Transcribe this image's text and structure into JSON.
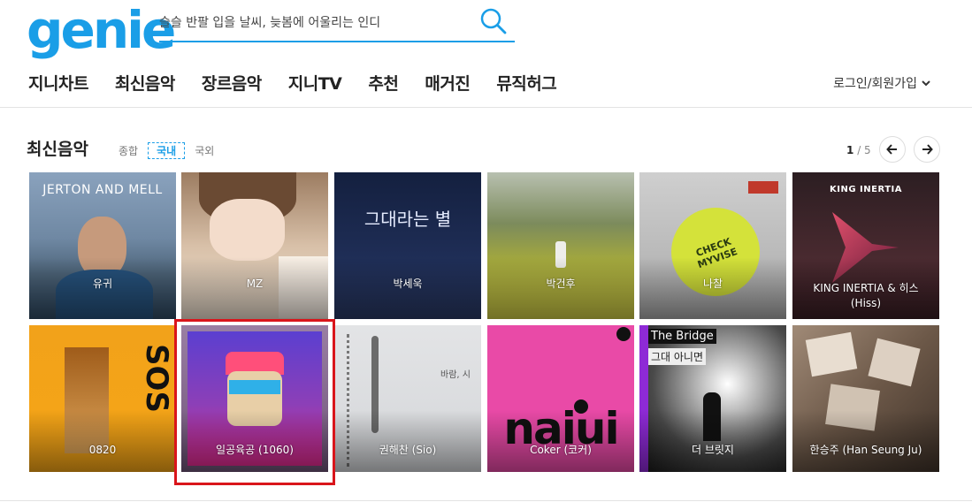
{
  "header": {
    "logo": "genie",
    "search_placeholder": "슬슬 반팔 입을 날씨, 늦봄에 어울리는 인디",
    "search_icon": "search-icon"
  },
  "nav": [
    "지니차트",
    "최신음악",
    "장르음악",
    "지니TV",
    "추천",
    "매거진",
    "뮤직허그"
  ],
  "login": "로그인/회원가입",
  "section": {
    "title": "최신음악",
    "filters": [
      "종합",
      "국내",
      "국외"
    ],
    "active_filter": "국내",
    "page_current": "1",
    "page_total": "/ 5"
  },
  "albums": [
    {
      "artist": "유귀",
      "cover_text": "JERTON AND MELL"
    },
    {
      "artist": "MZ",
      "cover_text": ""
    },
    {
      "artist": "박세욱",
      "cover_text": "그대라는 별"
    },
    {
      "artist": "박건후",
      "cover_text": ""
    },
    {
      "artist": "나찰",
      "cover_text": "CHECK MYVISE"
    },
    {
      "artist": "KING INERTIA & 히스 (Hiss)",
      "cover_text": "KING INERTIA"
    },
    {
      "artist": "0820",
      "cover_text": "SOS"
    },
    {
      "artist": "일공육공 (1060)",
      "cover_text": ""
    },
    {
      "artist": "권해찬 (Sio)",
      "cover_text": "바람, 시"
    },
    {
      "artist": "Coker (코커)",
      "cover_text": "naiui"
    },
    {
      "artist": "더 브릿지",
      "cover_text": "The Bridge",
      "cover_text2": "그대 아니면"
    },
    {
      "artist": "한승주 (Han Seung Ju)",
      "cover_text": ""
    }
  ],
  "colors": {
    "brand": "#1a9ee7",
    "highlight": "#d9151b"
  }
}
